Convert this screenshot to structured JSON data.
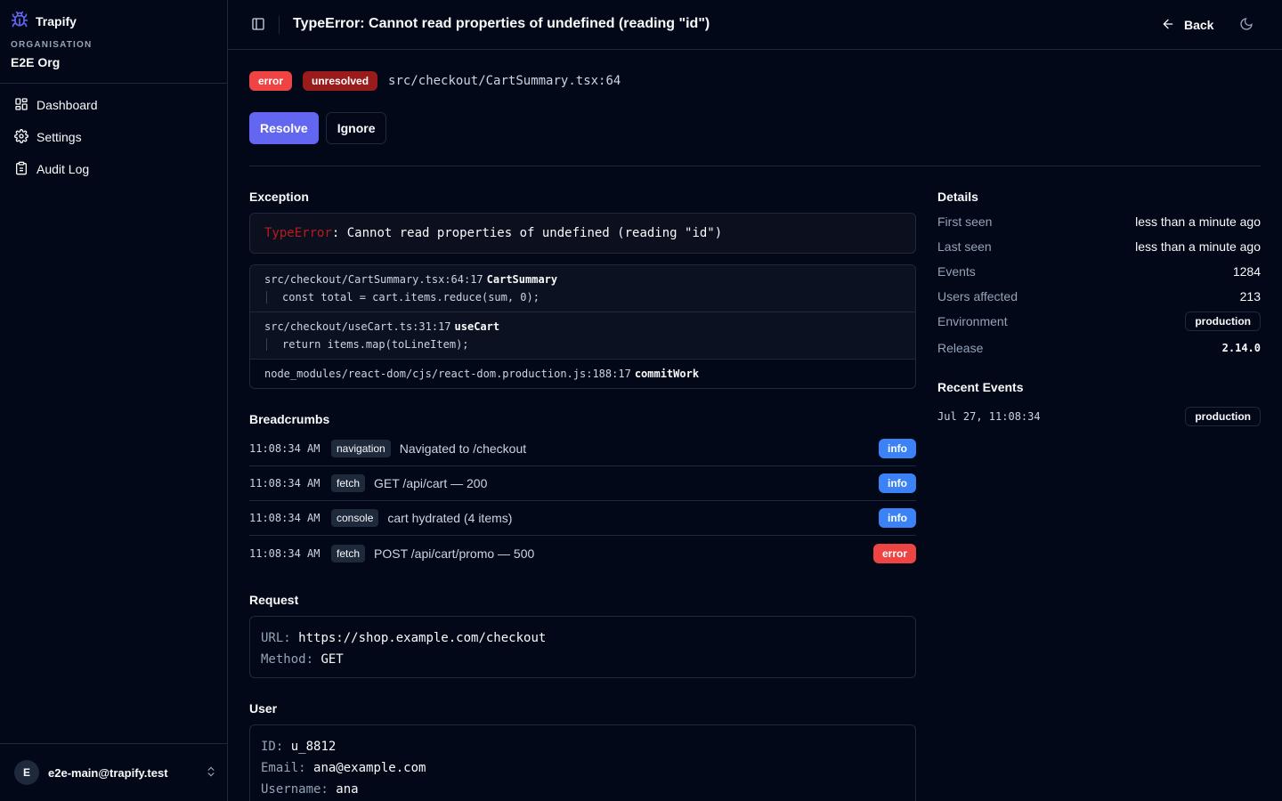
{
  "sidebar": {
    "brand": "Trapify",
    "org_label": "ORGANISATION",
    "org_name": "E2E Org",
    "nav": [
      {
        "label": "Dashboard",
        "icon": "grid-icon"
      },
      {
        "label": "Settings",
        "icon": "gear-icon"
      },
      {
        "label": "Audit Log",
        "icon": "clipboard-icon"
      }
    ],
    "user": {
      "initial": "E",
      "email": "e2e-main@trapify.test"
    }
  },
  "header": {
    "title": "TypeError: Cannot read properties of undefined (reading \"id\")",
    "back_label": "Back"
  },
  "issue": {
    "level": "error",
    "status": "unresolved",
    "location": "src/checkout/CartSummary.tsx:64",
    "resolve_label": "Resolve",
    "ignore_label": "Ignore"
  },
  "exception": {
    "section_title": "Exception",
    "type": "TypeError",
    "separator": ":",
    "message": " Cannot read properties of undefined (reading \"id\")",
    "frames": [
      {
        "file": "src/checkout/CartSummary.tsx:64:17",
        "fn": "CartSummary",
        "code": "const total = cart.items.reduce(sum, 0);"
      },
      {
        "file": "src/checkout/useCart.ts:31:17",
        "fn": "useCart",
        "code": "return items.map(toLineItem);"
      },
      {
        "file": "node_modules/react-dom/cjs/react-dom.production.js:188:17",
        "fn": "commitWork"
      }
    ]
  },
  "breadcrumbs": {
    "section_title": "Breadcrumbs",
    "items": [
      {
        "time": "11:08:34 AM",
        "category": "navigation",
        "message": "Navigated to /checkout",
        "level": "info"
      },
      {
        "time": "11:08:34 AM",
        "category": "fetch",
        "message": "GET /api/cart — 200",
        "level": "info"
      },
      {
        "time": "11:08:34 AM",
        "category": "console",
        "message": "cart hydrated (4 items)",
        "level": "info"
      },
      {
        "time": "11:08:34 AM",
        "category": "fetch",
        "message": "POST /api/cart/promo — 500",
        "level": "error"
      }
    ]
  },
  "request": {
    "section_title": "Request",
    "url_key": "URL:",
    "url": "https://shop.example.com/checkout",
    "method_key": "Method:",
    "method": "GET"
  },
  "user": {
    "section_title": "User",
    "id_key": "ID:",
    "id": "u_8812",
    "email_key": "Email:",
    "email": "ana@example.com",
    "username_key": "Username:",
    "username": "ana"
  },
  "details": {
    "section_title": "Details",
    "first_seen_label": "First seen",
    "first_seen": "less than a minute ago",
    "last_seen_label": "Last seen",
    "last_seen": "less than a minute ago",
    "events_label": "Events",
    "events": "1284",
    "users_label": "Users affected",
    "users": "213",
    "env_label": "Environment",
    "env": "production",
    "release_label": "Release",
    "release": "2.14.0"
  },
  "recent_events": {
    "section_title": "Recent Events",
    "items": [
      {
        "time": "Jul 27, 11:08:34",
        "env": "production"
      }
    ]
  },
  "colors": {
    "background": "#020817",
    "border": "#1e293b",
    "primary": "#6366f1",
    "error": "#ef4444",
    "info": "#3b82f6"
  }
}
